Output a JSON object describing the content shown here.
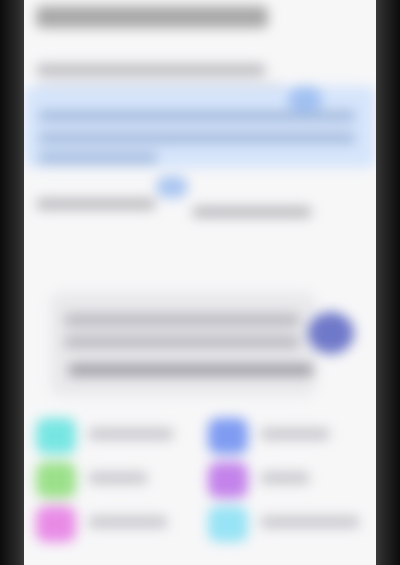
{
  "colors": {
    "background": "#f7f7f8",
    "highlight": "#d6e5fb",
    "accent": "#6f79c9"
  },
  "grid": {
    "items": [
      {
        "icon": "cyan-app-icon",
        "color": "#77e6e2"
      },
      {
        "icon": "blue-app-icon",
        "color": "#7f9cf2"
      },
      {
        "icon": "green-app-icon",
        "color": "#9be08a"
      },
      {
        "icon": "purple-app-icon",
        "color": "#c383ea"
      },
      {
        "icon": "magenta-app-icon",
        "color": "#e88be6"
      },
      {
        "icon": "light-cyan-app-icon",
        "color": "#98e3f5"
      }
    ]
  }
}
